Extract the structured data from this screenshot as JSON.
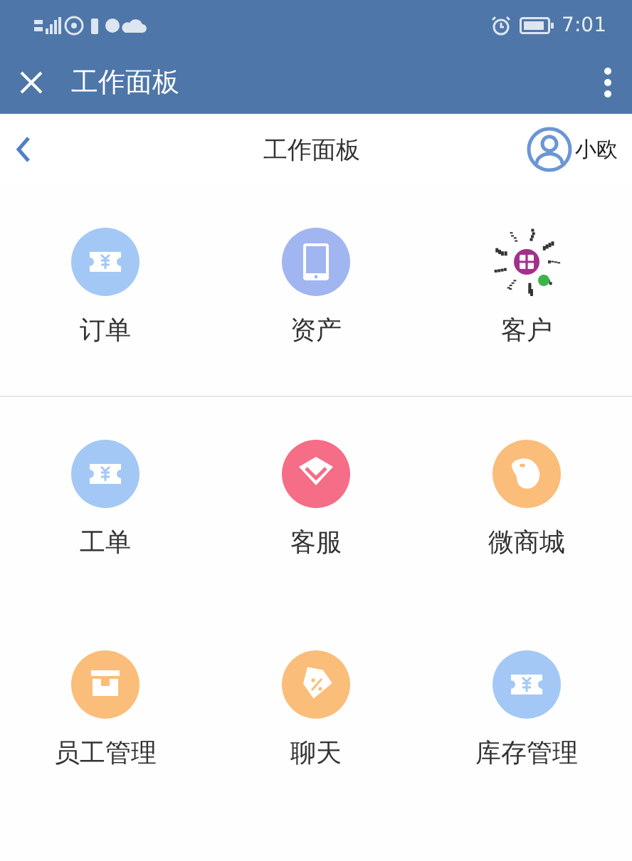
{
  "status_bar": {
    "time": "7:01"
  },
  "title_bar": {
    "title": "工作面板"
  },
  "header": {
    "title": "工作面板",
    "user": "小欧"
  },
  "sections": [
    {
      "items": [
        {
          "label": "订单",
          "kind": "ticket",
          "color": "#a3c8f5"
        },
        {
          "label": "资产",
          "kind": "phone",
          "color": "#a1b6f0"
        },
        {
          "label": "客户",
          "kind": "qr",
          "color": "#a3308a"
        }
      ]
    },
    {
      "items": [
        {
          "label": "工单",
          "kind": "ticket",
          "color": "#a3c8f5"
        },
        {
          "label": "客服",
          "kind": "diamond",
          "color": "#f56d87"
        },
        {
          "label": "微商城",
          "kind": "bean",
          "color": "#fbbd7a"
        },
        {
          "label": "员工管理",
          "kind": "box",
          "color": "#fbbd7a"
        },
        {
          "label": "聊天",
          "kind": "tag",
          "color": "#fbbd7a"
        },
        {
          "label": "库存管理",
          "kind": "ticket",
          "color": "#a3c8f5"
        }
      ]
    }
  ]
}
